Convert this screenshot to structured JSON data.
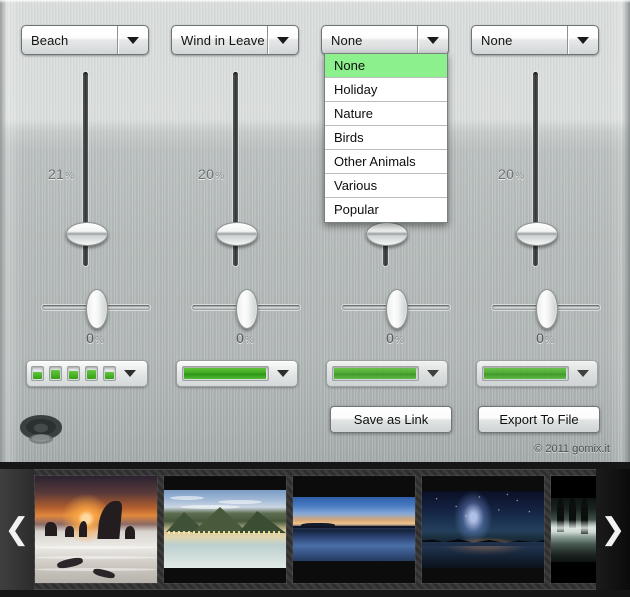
{
  "app": {
    "copyright": "© 2011 gomix.it"
  },
  "channels": [
    {
      "id": "channel-1",
      "category": "Beach",
      "volume_label": "21",
      "volume_symbol": "%",
      "pan_label": "0",
      "pan_symbol": "%",
      "meter_style": "segmented"
    },
    {
      "id": "channel-2",
      "category": "Wind in Leave",
      "volume_label": "20",
      "volume_symbol": "%",
      "pan_label": "0",
      "pan_symbol": "%",
      "meter_style": "bar"
    },
    {
      "id": "channel-3",
      "category": "None",
      "volume_label": "",
      "volume_symbol": "",
      "pan_label": "0",
      "pan_symbol": "%",
      "meter_style": "bar"
    },
    {
      "id": "channel-4",
      "category": "None",
      "volume_label": "20",
      "volume_symbol": "%",
      "pan_label": "0",
      "pan_symbol": "%",
      "meter_style": "bar"
    }
  ],
  "dropdown": {
    "open_on_channel": 3,
    "selected": "None",
    "options": [
      "None",
      "Holiday",
      "Nature",
      "Birds",
      "Other Animals",
      "Various",
      "Popular"
    ]
  },
  "buttons": {
    "save_as_link": "Save as Link",
    "export_to_file": "Export To File"
  },
  "gallery": {
    "prev_arrow": "❮",
    "next_arrow": "❯",
    "thumbnails": [
      {
        "name": "sea-stacks-sunset"
      },
      {
        "name": "beach-bay-mountains"
      },
      {
        "name": "blue-twilight-lake"
      },
      {
        "name": "milky-way-night-sky"
      },
      {
        "name": "misty-forest-reflection"
      }
    ]
  },
  "colors": {
    "meter_green": "#3faa20",
    "dropdown_highlight": "#8cf08c",
    "panel_metal": "#b3b9b8"
  }
}
